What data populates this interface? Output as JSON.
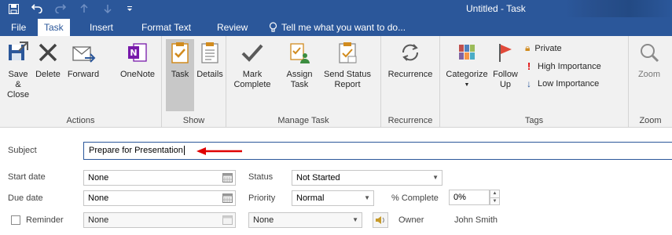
{
  "window": {
    "title": "Untitled - Task"
  },
  "quick_access": {
    "save_icon": "save-icon",
    "undo_icon": "undo-icon",
    "redo_icon": "redo-icon",
    "up_icon": "up-icon",
    "down_icon": "down-icon",
    "customize_icon": "customize-icon"
  },
  "tabs": [
    {
      "label": "File"
    },
    {
      "label": "Task"
    },
    {
      "label": "Insert"
    },
    {
      "label": "Format Text"
    },
    {
      "label": "Review"
    }
  ],
  "tell_me": "Tell me what you want to do...",
  "ribbon": {
    "actions": {
      "group_label": "Actions",
      "save_close": [
        "Save &",
        "Close"
      ],
      "delete": "Delete",
      "forward": "Forward",
      "onenote": "OneNote"
    },
    "show": {
      "group_label": "Show",
      "task": "Task",
      "details": "Details"
    },
    "manage": {
      "group_label": "Manage Task",
      "mark_complete": [
        "Mark",
        "Complete"
      ],
      "assign_task": [
        "Assign",
        "Task"
      ],
      "send_status": [
        "Send Status",
        "Report"
      ]
    },
    "recurrence": {
      "group_label": "Recurrence",
      "recurrence": "Recurrence"
    },
    "tags": {
      "group_label": "Tags",
      "categorize": "Categorize",
      "follow_up": [
        "Follow",
        "Up"
      ],
      "private": "Private",
      "high": "High Importance",
      "low": "Low Importance"
    },
    "zoom": {
      "group_label": "Zoom",
      "zoom": "Zoom"
    }
  },
  "form": {
    "subject_label": "Subject",
    "subject_value": "Prepare for Presentation",
    "start_date_label": "Start date",
    "start_date_value": "None",
    "due_date_label": "Due date",
    "due_date_value": "None",
    "reminder_label": "Reminder",
    "reminder_date": "None",
    "reminder_time": "None",
    "status_label": "Status",
    "status_value": "Not Started",
    "priority_label": "Priority",
    "priority_value": "Normal",
    "complete_label": "% Complete",
    "complete_value": "0%",
    "owner_label": "Owner",
    "owner_value": "John Smith"
  },
  "colors": {
    "accent": "#2b579a",
    "arrow": "#e00000"
  }
}
